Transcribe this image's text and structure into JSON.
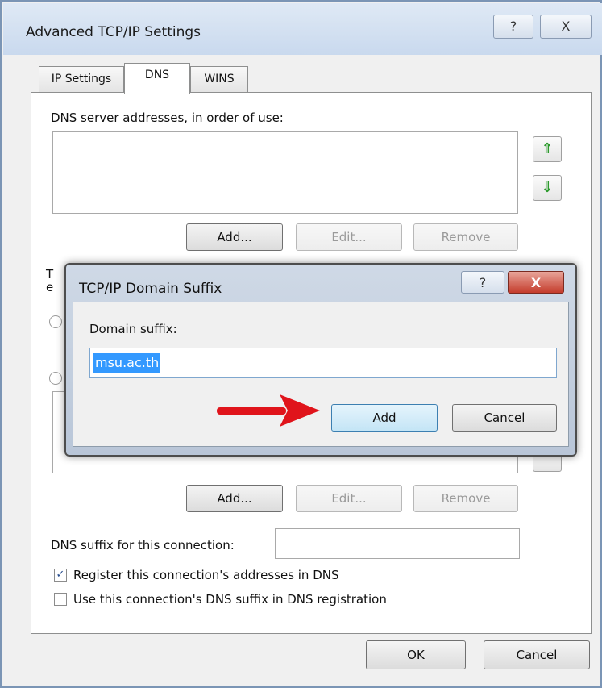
{
  "window": {
    "title": "Advanced TCP/IP Settings",
    "help_glyph": "?",
    "close_glyph": "X"
  },
  "tabs": [
    {
      "label": "IP Settings"
    },
    {
      "label": "DNS"
    },
    {
      "label": "WINS"
    }
  ],
  "dns": {
    "servers_label": "DNS server addresses, in order of use:",
    "up_icon": "up-arrow-icon",
    "down_icon": "down-arrow-icon",
    "servers_buttons": {
      "add": "Add...",
      "edit": "Edit...",
      "remove": "Remove"
    },
    "obscured_label_fragments": [
      "T",
      "e"
    ],
    "suffix_buttons": {
      "add": "Add...",
      "edit": "Edit...",
      "remove": "Remove"
    },
    "connection_suffix_label": "DNS suffix for this connection:",
    "connection_suffix_value": "",
    "register_label": "Register this connection's addresses in DNS",
    "register_checked": true,
    "use_suffix_label": "Use this connection's DNS suffix in DNS registration",
    "use_suffix_checked": false
  },
  "footer": {
    "ok": "OK",
    "cancel": "Cancel"
  },
  "modal": {
    "title": "TCP/IP Domain Suffix",
    "help_glyph": "?",
    "close_glyph": "X",
    "field_label": "Domain suffix:",
    "field_value": "msu.ac.th",
    "add": "Add",
    "cancel": "Cancel",
    "annotation": "red-arrow-pointing-to-add"
  },
  "colors": {
    "accent_arrow": "#e0141b",
    "selection": "#3399ff",
    "close_red": "#c43b2b"
  }
}
